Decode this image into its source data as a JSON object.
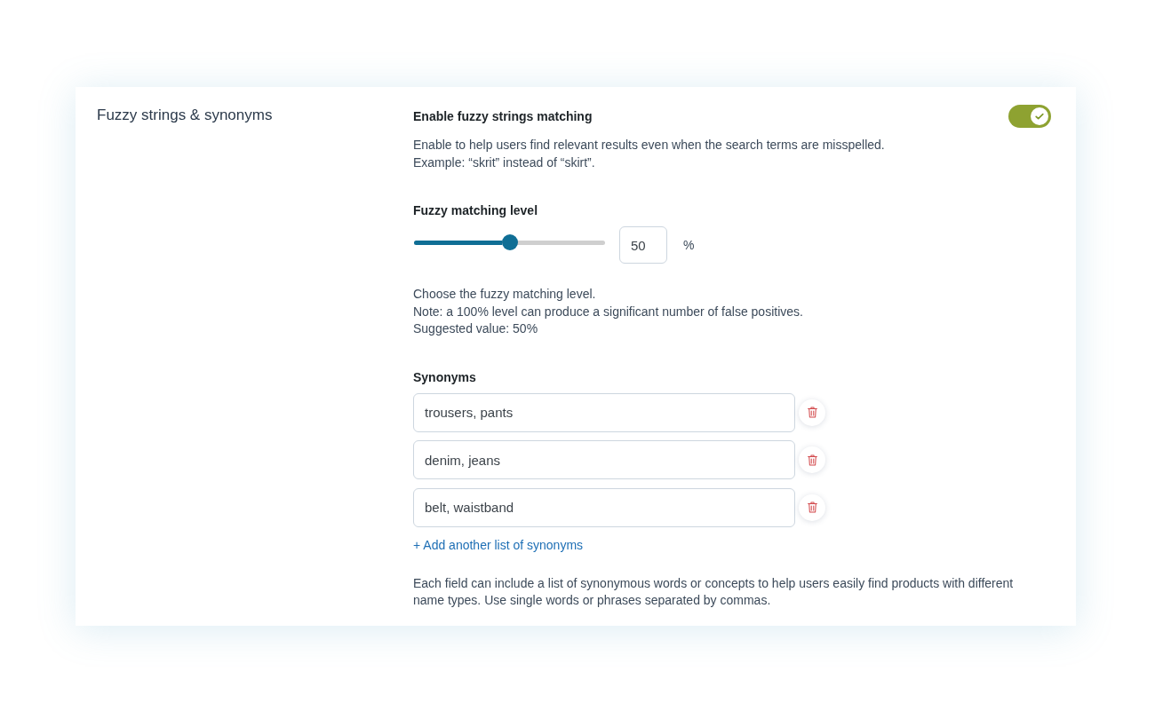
{
  "section": {
    "title": "Fuzzy strings & synonyms"
  },
  "fuzzy_matching": {
    "label": "Enable fuzzy strings matching",
    "on": true,
    "description": [
      "Enable to help users find relevant results even when the search terms are misspelled.",
      "Example: “skrit” instead of “skirt”."
    ]
  },
  "matching_level": {
    "label": "Fuzzy matching level",
    "level": 0.5,
    "value": "50",
    "unit": "%",
    "help": [
      "Choose the fuzzy matching level.",
      "Note: a 100% level can produce a significant number of false positives.",
      "Suggested value: 50%"
    ]
  },
  "synonyms": {
    "label": "Synonyms",
    "items": [
      {
        "value": "trousers, pants"
      },
      {
        "value": "denim, jeans"
      },
      {
        "value": "belt, waistband"
      }
    ],
    "add_link": "+ Add another list of synonyms",
    "help": "Each field can include a list of synonymous words or concepts to help users easily find products with different name types. Use single words or phrases separated by commas."
  }
}
